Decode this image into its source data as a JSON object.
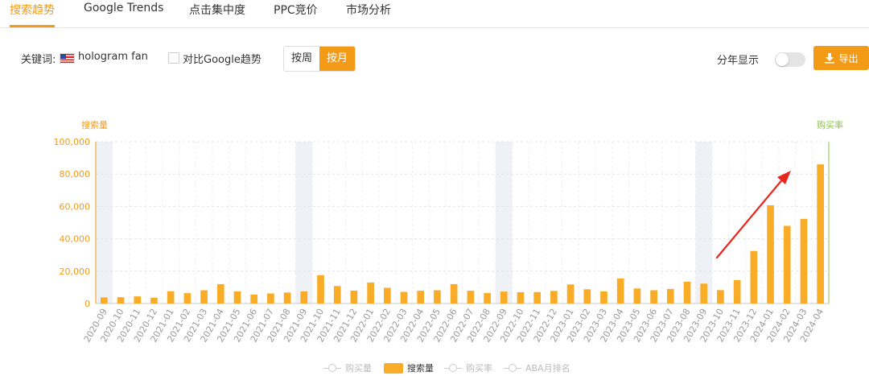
{
  "tabs": [
    {
      "label": "搜索趋势",
      "active": true
    },
    {
      "label": "Google Trends",
      "active": false
    },
    {
      "label": "点击集中度",
      "active": false
    },
    {
      "label": "PPC竞价",
      "active": false
    },
    {
      "label": "市场分析",
      "active": false
    }
  ],
  "toolbar": {
    "keyword_label": "关键词:",
    "keyword": "hologram fan",
    "compare_label": "对比Google趋势",
    "compare_checked": false,
    "week_label": "按周",
    "month_label": "按月",
    "period_selected": "按月",
    "year_split_label": "分年显示",
    "year_split_on": false,
    "export_label": "导出"
  },
  "colors": {
    "accent": "#f39a17",
    "bar": "#f9ac28",
    "right_axis": "#8bc34a",
    "highlight_band": "#eef1f6",
    "arrow": "#e8261f"
  },
  "chart_data": {
    "type": "bar",
    "left_axis_title": "搜索量",
    "right_axis_title": "购买率",
    "ylim": [
      0,
      100000
    ],
    "y_ticks": [
      "0",
      "20,000",
      "40,000",
      "60,000",
      "80,000",
      "100,000"
    ],
    "categories": [
      "2020-09",
      "2020-10",
      "2020-11",
      "2020-12",
      "2021-01",
      "2021-02",
      "2021-03",
      "2021-04",
      "2021-05",
      "2021-06",
      "2021-07",
      "2021-08",
      "2021-09",
      "2021-10",
      "2021-11",
      "2021-12",
      "2022-01",
      "2022-02",
      "2022-03",
      "2022-04",
      "2022-05",
      "2022-06",
      "2022-07",
      "2022-08",
      "2022-09",
      "2022-10",
      "2022-11",
      "2022-12",
      "2023-01",
      "2023-02",
      "2023-03",
      "2023-04",
      "2023-05",
      "2023-06",
      "2023-07",
      "2023-08",
      "2023-09",
      "2023-10",
      "2023-11",
      "2023-12",
      "2024-01",
      "2024-02",
      "2024-03",
      "2024-04"
    ],
    "series": [
      {
        "name": "搜索量",
        "values": [
          3800,
          3900,
          4400,
          3600,
          7600,
          6400,
          8200,
          12000,
          7500,
          5500,
          6200,
          6800,
          7500,
          17500,
          10800,
          8000,
          13000,
          9700,
          7200,
          7900,
          8200,
          12000,
          7900,
          6500,
          7400,
          7000,
          7100,
          7800,
          11800,
          8800,
          7500,
          15500,
          9300,
          8200,
          9000,
          13500,
          12300,
          8300,
          14500,
          32500,
          60700,
          48000,
          52300,
          86000
        ]
      }
    ],
    "highlighted_categories": [
      "2020-09",
      "2021-09",
      "2022-09",
      "2023-09"
    ],
    "grid": true,
    "legend_position": "bottom",
    "legend": [
      {
        "name": "购买量",
        "active": false
      },
      {
        "name": "搜索量",
        "active": true
      },
      {
        "name": "购买率",
        "active": false
      },
      {
        "name": "ABA月排名",
        "active": false
      }
    ]
  }
}
